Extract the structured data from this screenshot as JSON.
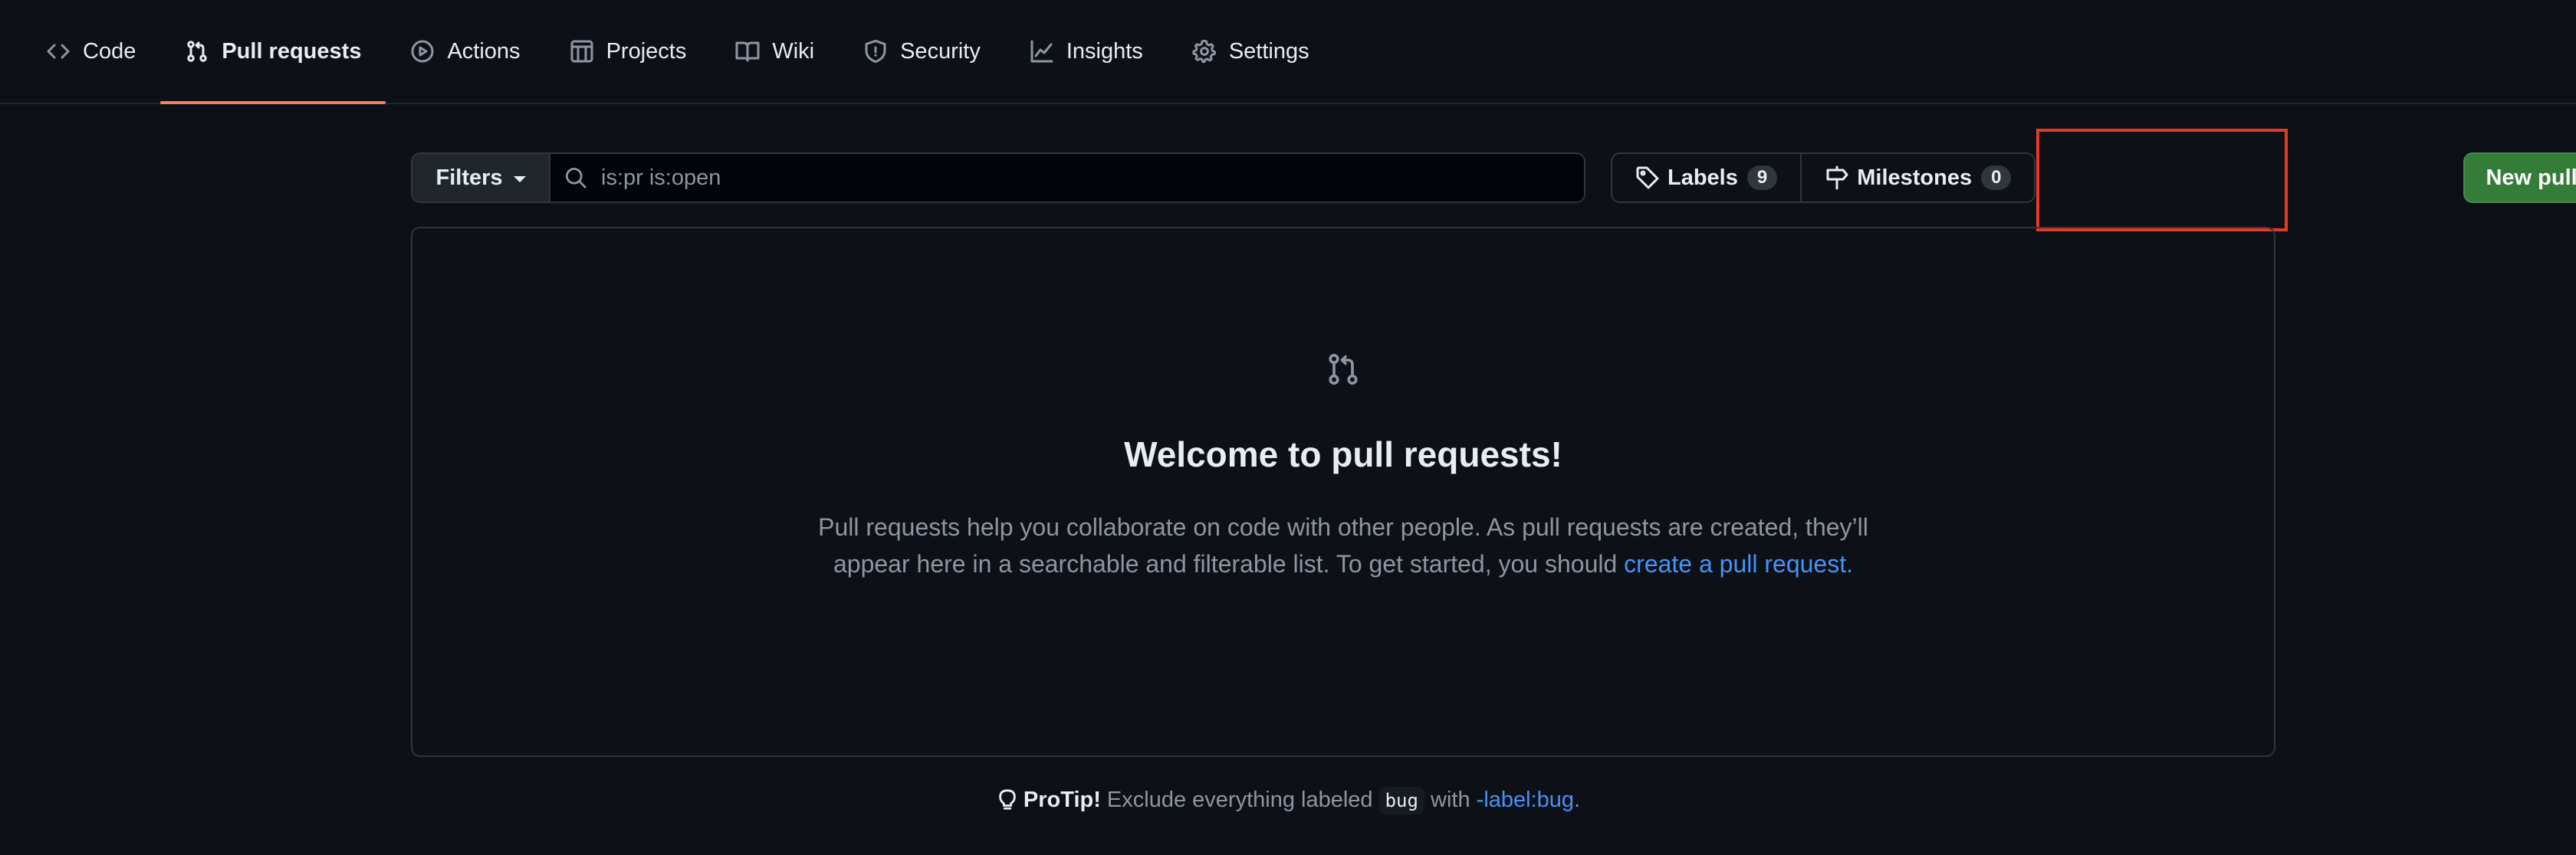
{
  "nav": {
    "items": [
      {
        "label": "Code",
        "icon": "code-icon"
      },
      {
        "label": "Pull requests",
        "icon": "git-pull-request-icon",
        "selected": true
      },
      {
        "label": "Actions",
        "icon": "play-icon"
      },
      {
        "label": "Projects",
        "icon": "table-icon"
      },
      {
        "label": "Wiki",
        "icon": "book-icon"
      },
      {
        "label": "Security",
        "icon": "shield-icon"
      },
      {
        "label": "Insights",
        "icon": "graph-icon"
      },
      {
        "label": "Settings",
        "icon": "gear-icon"
      }
    ]
  },
  "subnav": {
    "filters_label": "Filters",
    "search_value": "is:pr is:open",
    "labels_label": "Labels",
    "labels_count": "9",
    "milestones_label": "Milestones",
    "milestones_count": "0",
    "new_pr_label": "New pull request"
  },
  "blankslate": {
    "title": "Welcome to pull requests!",
    "desc_text": "Pull requests help you collaborate on code with other people. As pull requests are created, they’ll appear here in a searchable and filterable list. To get started, you should ",
    "desc_link": "create a pull request",
    "desc_end": "."
  },
  "protip": {
    "strong": "ProTip!",
    "text_before": " Exclude everything labeled ",
    "code": "bug",
    "text_mid": " with ",
    "link": "-label:bug",
    "text_end": "."
  },
  "colors": {
    "background": "#0d1117",
    "accent_underline": "#f78166",
    "primary_button": "#347d39",
    "link": "#4493f8",
    "highlight_box": "#e03b24"
  }
}
